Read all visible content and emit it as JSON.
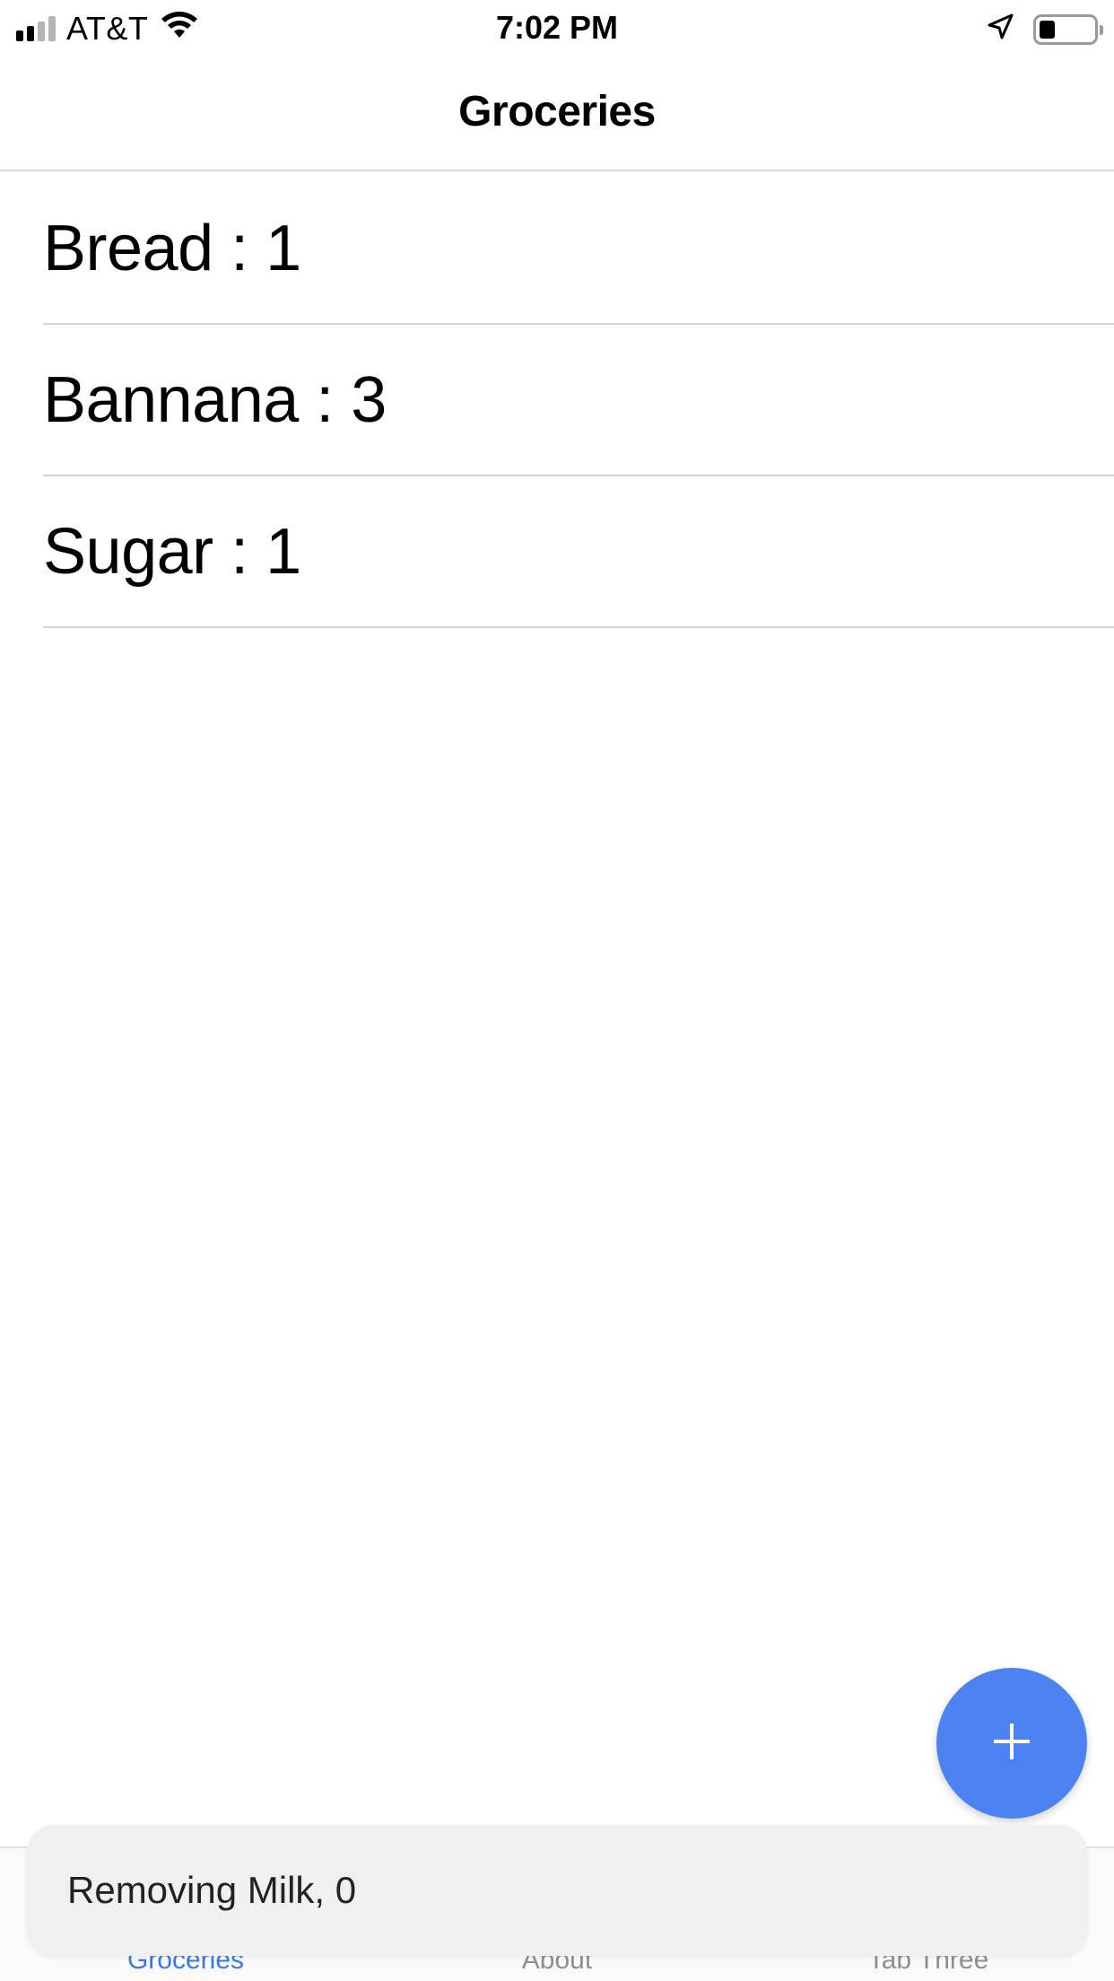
{
  "status_bar": {
    "carrier": "AT&T",
    "time": "7:02 PM",
    "battery_level": 0.3
  },
  "nav": {
    "title": "Groceries"
  },
  "list": {
    "items": [
      {
        "label": "Bread : 1"
      },
      {
        "label": "Bannana : 3"
      },
      {
        "label": "Sugar : 1"
      }
    ]
  },
  "toast": {
    "message": "Removing Milk, 0"
  },
  "tabs": [
    {
      "label": "Groceries",
      "active": true
    },
    {
      "label": "About",
      "active": false
    },
    {
      "label": "Tab Three",
      "active": false
    }
  ],
  "colors": {
    "accent": "#3a78e8",
    "fab": "#4d82f3",
    "toast_bg": "#f0f0f0"
  },
  "icons": {
    "fab": "plus-icon",
    "wifi": "wifi-icon",
    "location": "location-arrow-icon",
    "signal": "cell-signal-icon",
    "battery": "battery-icon"
  }
}
